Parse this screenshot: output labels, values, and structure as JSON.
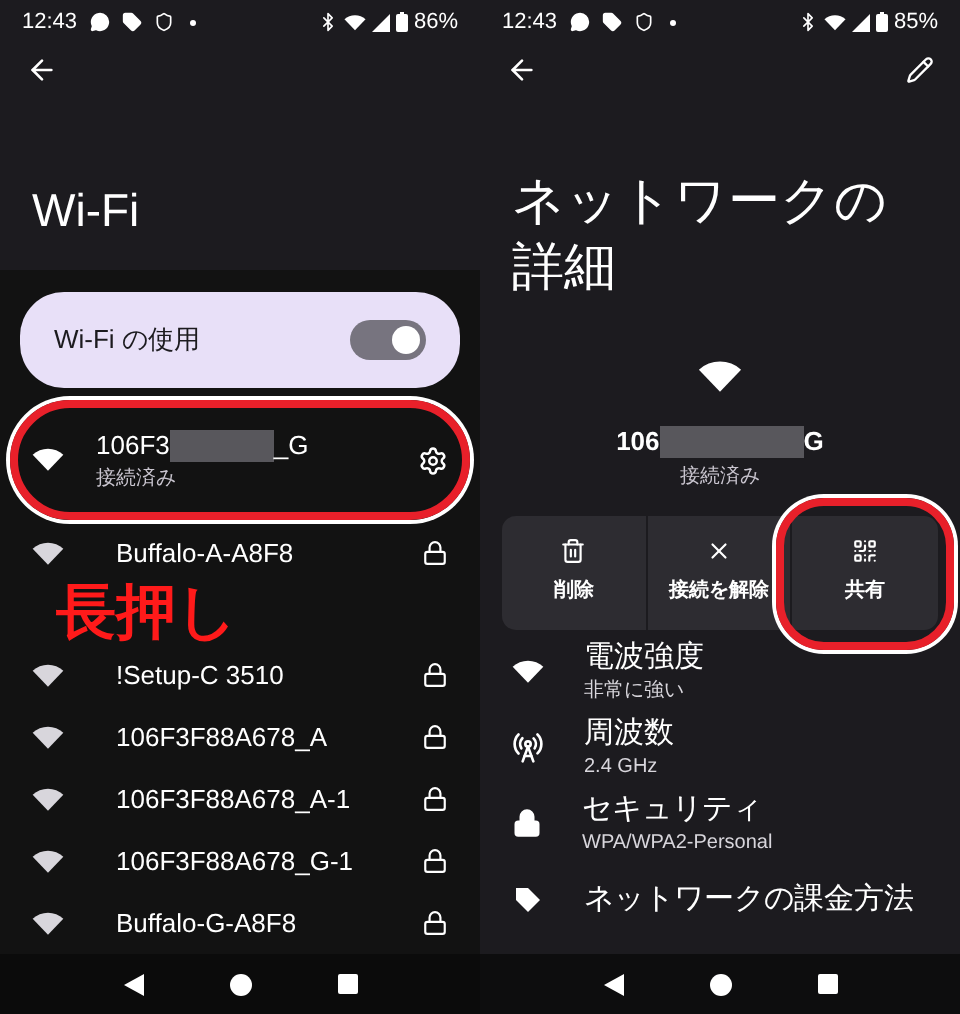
{
  "left": {
    "status_bar": {
      "time": "12:43",
      "battery": "86%"
    },
    "title": "Wi-Fi",
    "wifi_toggle": {
      "label": "Wi-Fi の使用",
      "on": true
    },
    "connected": {
      "name_start": "106F3",
      "name_end": "_G",
      "status": "接続済み",
      "highlighted": true
    },
    "networks": [
      {
        "name": "Buffalo-A-A8F8",
        "locked": true
      },
      {
        "name": "!Setup-C 3510",
        "locked": true
      },
      {
        "name": "106F3F88A678_A",
        "locked": true
      },
      {
        "name": "106F3F88A678_A-1",
        "locked": true
      },
      {
        "name": "106F3F88A678_G-1",
        "locked": true
      },
      {
        "name": "Buffalo-G-A8F8",
        "locked": true
      }
    ],
    "annotation": "長押し"
  },
  "right": {
    "status_bar": {
      "time": "12:43",
      "battery": "85%"
    },
    "title": "ネットワークの詳細",
    "network": {
      "name_start": "106",
      "name_end": "G",
      "status": "接続済み"
    },
    "actions": [
      {
        "kind": "delete",
        "label": "削除",
        "highlighted": false
      },
      {
        "kind": "disconnect",
        "label": "接続を解除",
        "highlighted": false
      },
      {
        "kind": "share",
        "label": "共有",
        "highlighted": true
      }
    ],
    "details": [
      {
        "kind": "signal",
        "label": "電波強度",
        "value": "非常に強い"
      },
      {
        "kind": "frequency",
        "label": "周波数",
        "value": "2.4 GHz"
      },
      {
        "kind": "security",
        "label": "セキュリティ",
        "value": "WPA/WPA2-Personal"
      },
      {
        "kind": "metered",
        "label": "ネットワークの課金方法"
      }
    ]
  }
}
